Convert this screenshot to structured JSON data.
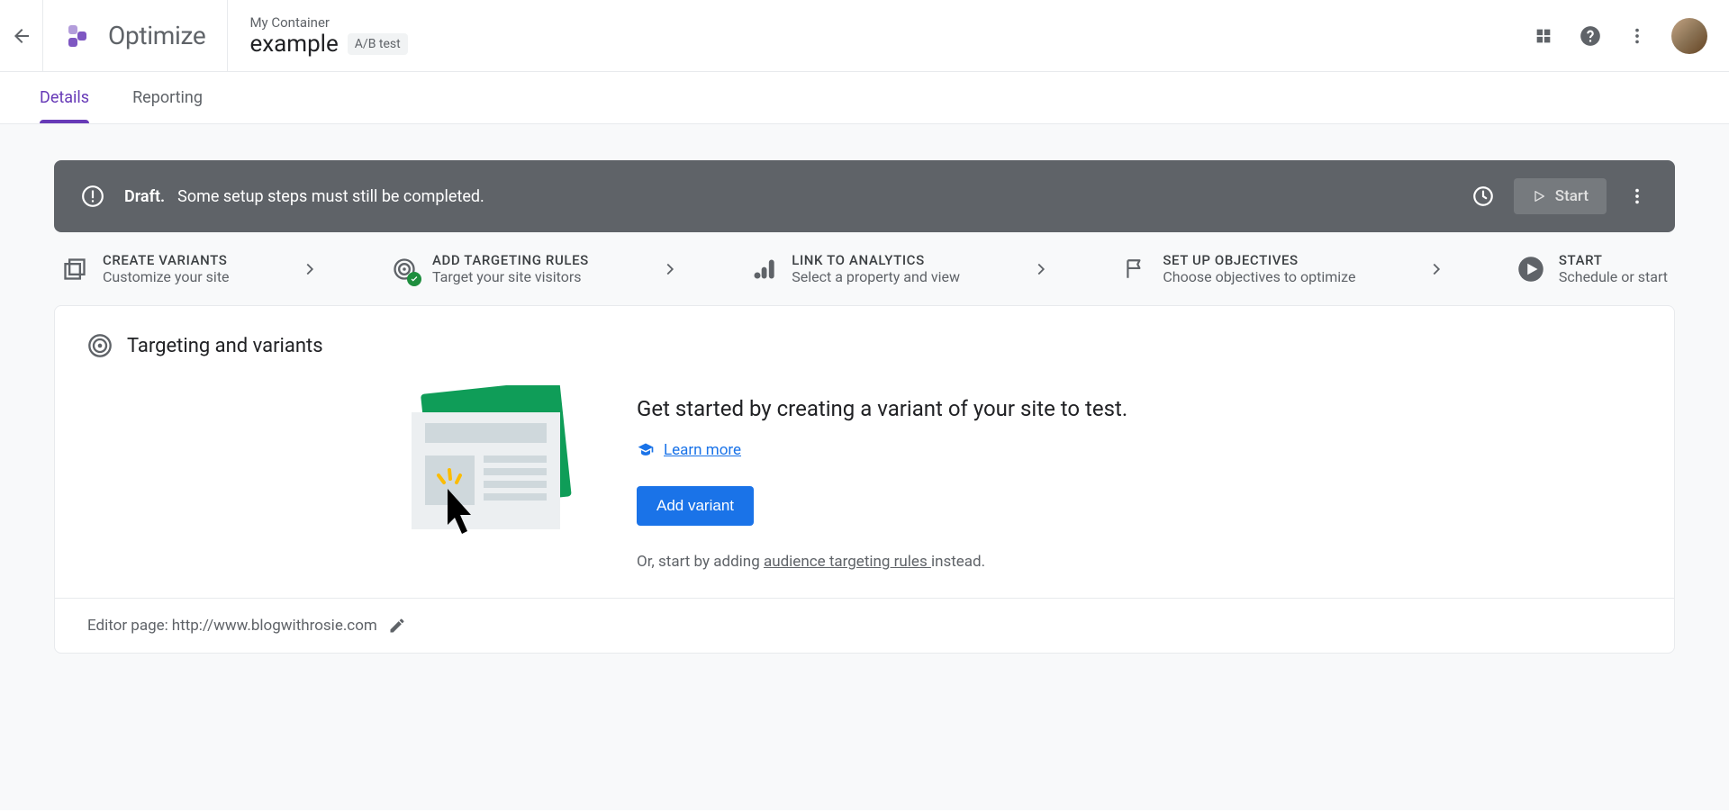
{
  "header": {
    "product_name": "Optimize",
    "container_name": "My Container",
    "experiment_name": "example",
    "experiment_type": "A/B test"
  },
  "tabs": {
    "details": "Details",
    "reporting": "Reporting"
  },
  "banner": {
    "status": "Draft.",
    "message": "Some setup steps must still be completed.",
    "start_label": "Start"
  },
  "steps": [
    {
      "title": "CREATE VARIANTS",
      "sub": "Customize your site"
    },
    {
      "title": "ADD TARGETING RULES",
      "sub": "Target your site visitors"
    },
    {
      "title": "LINK TO ANALYTICS",
      "sub": "Select a property and view"
    },
    {
      "title": "SET UP OBJECTIVES",
      "sub": "Choose objectives to optimize"
    },
    {
      "title": "START",
      "sub": "Schedule or start"
    }
  ],
  "card": {
    "title": "Targeting and variants",
    "headline": "Get started by creating a variant of your site to test.",
    "learn_more": "Learn more",
    "add_variant": "Add variant",
    "alt_prefix": "Or, start by adding ",
    "alt_link": "audience targeting rules ",
    "alt_suffix": "instead.",
    "editor_label": "Editor page: ",
    "editor_url": "http://www.blogwithrosie.com"
  }
}
